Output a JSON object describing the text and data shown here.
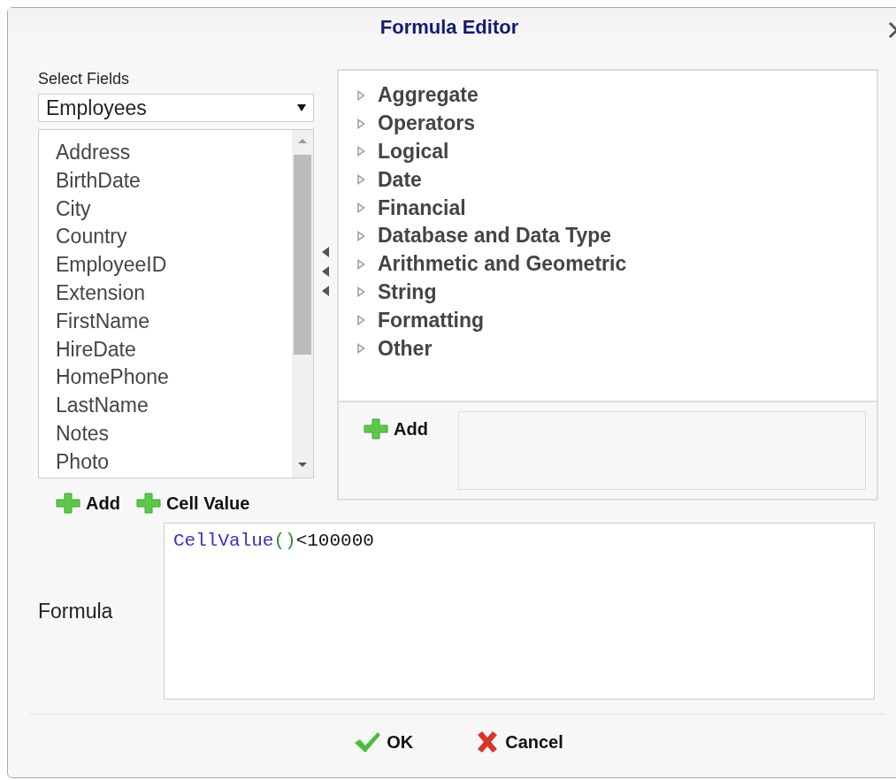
{
  "window": {
    "title": "Formula Editor"
  },
  "fields": {
    "label": "Select Fields",
    "table": "Employees",
    "items": [
      {
        "label": "Address",
        "selected": false
      },
      {
        "label": "BirthDate",
        "selected": false
      },
      {
        "label": "City",
        "selected": false
      },
      {
        "label": "Country",
        "selected": false
      },
      {
        "label": "EmployeeID",
        "selected": false
      },
      {
        "label": "Extension",
        "selected": false
      },
      {
        "label": "FirstName",
        "selected": false
      },
      {
        "label": "HireDate",
        "selected": false
      },
      {
        "label": "HomePhone",
        "selected": false
      },
      {
        "label": "LastName",
        "selected": false
      },
      {
        "label": "Notes",
        "selected": false
      },
      {
        "label": "Photo",
        "selected": false
      }
    ],
    "buttons": [
      "Add",
      "Cell Value"
    ]
  },
  "functions": {
    "categories": [
      {
        "label": "Aggregate",
        "expanded": false
      },
      {
        "label": "Operators",
        "expanded": false
      },
      {
        "label": "Logical",
        "expanded": false
      },
      {
        "label": "Date",
        "expanded": false
      },
      {
        "label": "Financial",
        "expanded": false
      },
      {
        "label": "Database and Data Type",
        "expanded": false
      },
      {
        "label": "Arithmetic and Geometric",
        "expanded": false
      },
      {
        "label": "String",
        "expanded": false
      },
      {
        "label": "Formatting",
        "expanded": false
      },
      {
        "label": "Other",
        "expanded": false
      }
    ],
    "add_button": "Add"
  },
  "formula": {
    "label": "Formula",
    "tokens": [
      {
        "text": "CellValue",
        "kind": "function"
      },
      {
        "text": "()",
        "kind": "paren"
      },
      {
        "text": "<100000",
        "kind": "plain"
      }
    ]
  },
  "buttons": [
    {
      "label": "OK",
      "kind": "ok"
    },
    {
      "label": "Cancel",
      "kind": "cancel"
    }
  ]
}
